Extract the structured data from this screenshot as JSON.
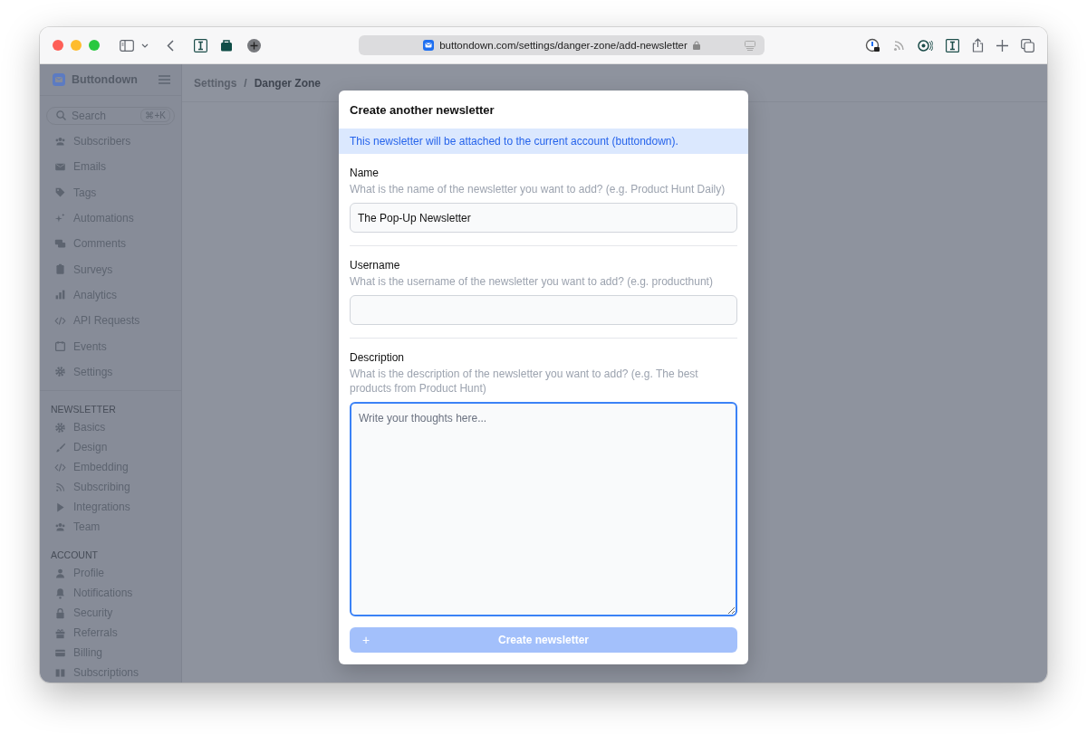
{
  "browser": {
    "url": "buttondown.com/settings/danger-zone/add-newsletter"
  },
  "sidebar": {
    "brand": "Buttondown",
    "search": {
      "placeholder": "Search",
      "shortcut": "⌘+K"
    },
    "items": [
      {
        "label": "Subscribers"
      },
      {
        "label": "Emails"
      },
      {
        "label": "Tags"
      },
      {
        "label": "Automations"
      },
      {
        "label": "Comments"
      },
      {
        "label": "Surveys"
      },
      {
        "label": "Analytics"
      },
      {
        "label": "API Requests"
      },
      {
        "label": "Events"
      },
      {
        "label": "Settings"
      }
    ],
    "sections": [
      {
        "heading": "NEWSLETTER",
        "items": [
          {
            "label": "Basics"
          },
          {
            "label": "Design"
          },
          {
            "label": "Embedding"
          },
          {
            "label": "Subscribing"
          },
          {
            "label": "Integrations"
          },
          {
            "label": "Team"
          }
        ]
      },
      {
        "heading": "ACCOUNT",
        "items": [
          {
            "label": "Profile"
          },
          {
            "label": "Notifications"
          },
          {
            "label": "Security"
          },
          {
            "label": "Referrals"
          },
          {
            "label": "Billing"
          },
          {
            "label": "Subscriptions"
          }
        ]
      }
    ]
  },
  "breadcrumb": [
    {
      "label": "Settings",
      "current": false
    },
    {
      "label": "/",
      "current": false
    },
    {
      "label": "Danger Zone",
      "current": true
    }
  ],
  "modal": {
    "title": "Create another newsletter",
    "notice": "This newsletter will be attached to the current account (buttondown).",
    "fields": [
      {
        "kind": "input",
        "label": "Name",
        "hint": "What is the name of the newsletter you want to add? (e.g. Product Hunt Daily)",
        "value": "The Pop-Up Newsletter",
        "focused": false
      },
      {
        "kind": "input",
        "label": "Username",
        "hint": "What is the username of the newsletter you want to add? (e.g. producthunt)",
        "focused": false
      },
      {
        "kind": "textarea",
        "label": "Description",
        "hint": "What is the description of the newsletter you want to add? (e.g. The best products from Product Hunt)",
        "placeholder": "Write your thoughts here...",
        "focused": true
      }
    ],
    "submit": {
      "icon": "+",
      "label": "Create newsletter",
      "disabled": true
    }
  }
}
